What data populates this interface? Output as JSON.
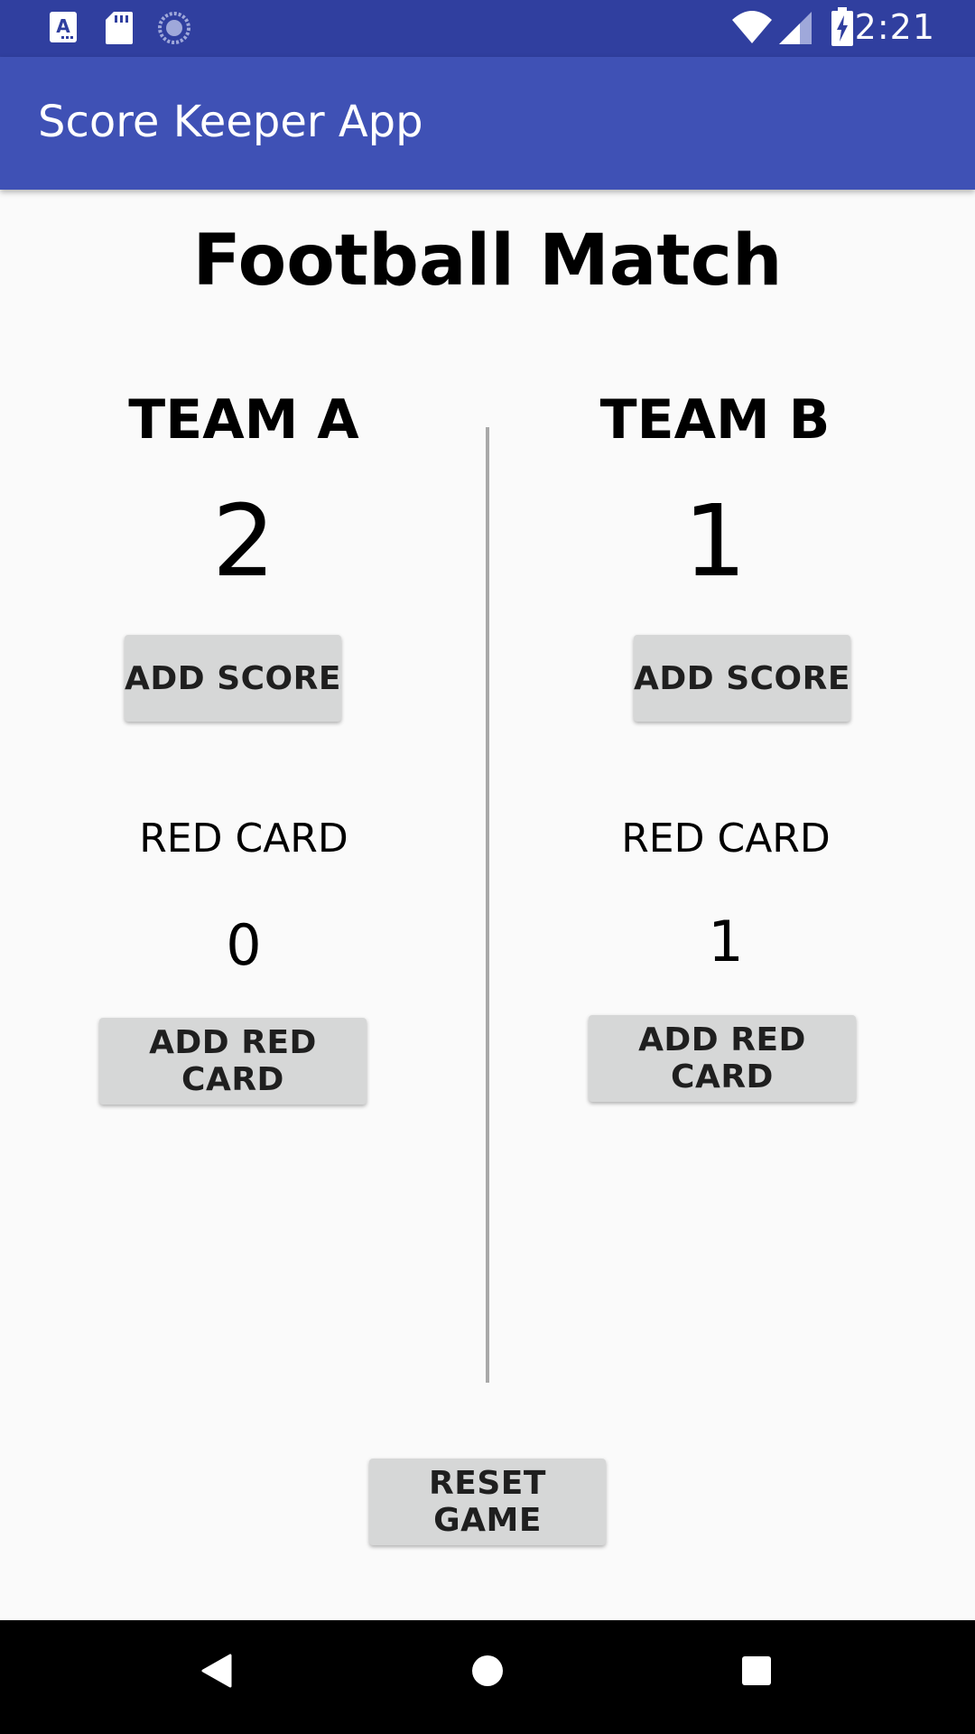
{
  "status_bar": {
    "time": "2:21",
    "icons": [
      "font-app-icon",
      "sd-card-icon",
      "sync-icon",
      "wifi-icon",
      "signal-icon",
      "battery-charging-icon"
    ]
  },
  "app_bar": {
    "title": "Score Keeper App"
  },
  "main": {
    "title": "Football Match",
    "team_a": {
      "name": "TEAM A",
      "score": "2",
      "add_score_label": "ADD SCORE",
      "red_card_label": "RED CARD",
      "red_card_count": "0",
      "add_red_card_label": "ADD RED CARD"
    },
    "team_b": {
      "name": "TEAM B",
      "score": "1",
      "add_score_label": "ADD SCORE",
      "red_card_label": "RED CARD",
      "red_card_count": "1",
      "add_red_card_label": "ADD RED CARD"
    },
    "reset_label": "RESET GAME"
  },
  "nav_bar": {
    "icons": [
      "back-icon",
      "home-icon",
      "recents-icon"
    ]
  },
  "colors": {
    "status_bar": "#303f9f",
    "app_bar": "#3f51b5",
    "button": "#d6d7d7",
    "background": "#fafafa"
  }
}
